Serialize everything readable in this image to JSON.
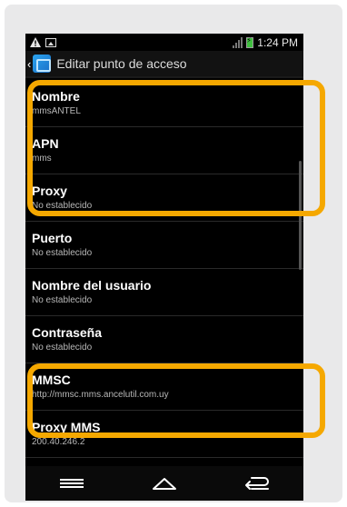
{
  "status_bar": {
    "left_icons": [
      "warning-icon",
      "image-icon"
    ],
    "right_icons": [
      "signal-icon",
      "battery-charging-icon"
    ],
    "time": "1:24 PM"
  },
  "action_bar": {
    "title": "Editar punto de acceso",
    "icon": "apn-settings-icon"
  },
  "items": [
    {
      "title": "Nombre",
      "value": "mmsANTEL"
    },
    {
      "title": "APN",
      "value": "mms"
    },
    {
      "title": "Proxy",
      "value": "No establecido"
    },
    {
      "title": "Puerto",
      "value": "No establecido"
    },
    {
      "title": "Nombre del usuario",
      "value": "No establecido"
    },
    {
      "title": "Contraseña",
      "value": "No establecido"
    },
    {
      "title": "MMSC",
      "value": "http://mmsc.mms.ancelutil.com.uy"
    },
    {
      "title": "Proxy MMS",
      "value": "200.40.246.2"
    }
  ],
  "nav_bar": {
    "buttons": [
      "menu-icon",
      "home-icon",
      "back-icon"
    ]
  },
  "colors": {
    "highlight": "#f5a800",
    "background": "#000000",
    "card": "#e9e9ea"
  }
}
